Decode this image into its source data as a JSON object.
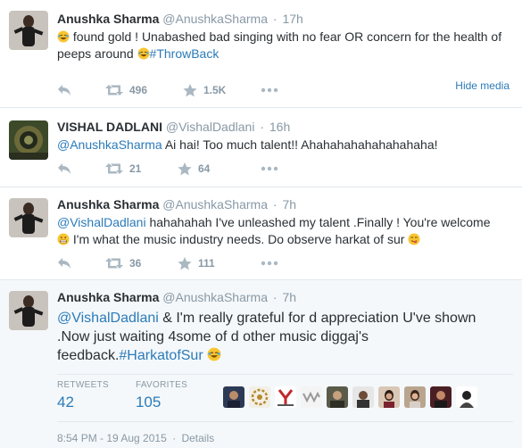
{
  "tweets": [
    {
      "name": "Anushka Sharma",
      "handle": "@AnushkaSharma",
      "separator": "·",
      "time": "17h",
      "text_before": " found gold ! Unabashed bad singing with no fear OR concern for the health of peeps around ",
      "hashtag": "#ThrowBack",
      "retweets": "496",
      "favorites": "1.5K",
      "hide_media": "Hide media"
    },
    {
      "name": "VISHAL DADLANI",
      "handle": "@VishalDadlani",
      "separator": "·",
      "time": "16h",
      "mention": "@AnushkaSharma",
      "text": " Ai hai! Too much talent!! Ahahahahahahahahaha!",
      "retweets": "21",
      "favorites": "64"
    },
    {
      "name": "Anushka Sharma",
      "handle": "@AnushkaSharma",
      "separator": "·",
      "time": "7h",
      "mention": "@VishalDadlani",
      "text_line1": " hahahahah I've unleashed my talent .Finally ! You're  welcome",
      "text_line2": " I'm what the music industry needs. Do observe harkat of sur ",
      "retweets": "36",
      "favorites": "111"
    },
    {
      "name": "Anushka Sharma",
      "handle": "@AnushkaSharma",
      "separator": "·",
      "time": "7h",
      "mention": "@VishalDadlani",
      "text": " & I'm really grateful for d appreciation U've shown .Now just waiting 4some of d other music diggaj's feedback.",
      "hashtag": "#HarkatofSur",
      "stats": {
        "retweets_label": "RETWEETS",
        "retweets_value": "42",
        "favorites_label": "FAVORITES",
        "favorites_value": "105"
      },
      "timestamp": "8:54 PM - 19 Aug 2015",
      "details": "Details"
    }
  ],
  "colors": {
    "link": "#2b7bb9",
    "muted": "#8899a6",
    "text": "#292f33",
    "border": "#e1e8ed"
  }
}
